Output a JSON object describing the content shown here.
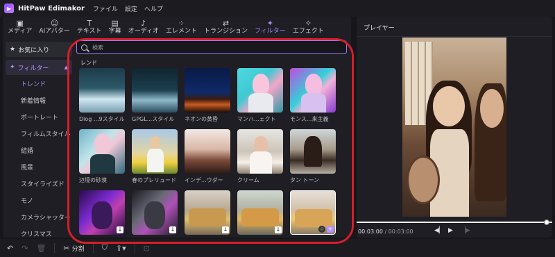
{
  "app": {
    "title": "HitPaw Edimakor"
  },
  "menu": [
    "ファイル",
    "設定",
    "ヘルプ"
  ],
  "toolbar": {
    "tools": [
      {
        "icon": "media-icon",
        "label": "メディア"
      },
      {
        "icon": "ai-avatar-icon",
        "label": "AIアバター"
      },
      {
        "icon": "text-icon",
        "label": "テキスト"
      },
      {
        "icon": "subtitle-icon",
        "label": "字幕"
      },
      {
        "icon": "audio-icon",
        "label": "オーディオ"
      },
      {
        "icon": "element-icon",
        "label": "エレメント"
      },
      {
        "icon": "transition-icon",
        "label": "トランジション"
      },
      {
        "icon": "filter-icon",
        "label": "フィルター"
      },
      {
        "icon": "effect-icon",
        "label": "エフェクト"
      }
    ],
    "active": "フィルター"
  },
  "sidebar": {
    "favorites": "お気に入り",
    "category": "フィルター",
    "items": [
      "トレンド",
      "新着情報",
      "ポートレート",
      "フィルムスタイル",
      "結婚",
      "風景",
      "スタイライズド",
      "モノ",
      "カメラシャッター",
      "クリスマス"
    ],
    "active": "トレンド"
  },
  "search": {
    "placeholder": "検索"
  },
  "section": {
    "title": "レンド"
  },
  "filters": [
    {
      "name": "Dlog ...9スタイル"
    },
    {
      "name": "GPGL...スタイル"
    },
    {
      "name": "ネオンの黄昏"
    },
    {
      "name": "マンハ...ェクト"
    },
    {
      "name": "モンス...来主義"
    },
    {
      "name": "辺境の砂漠"
    },
    {
      "name": "春のプレリュード"
    },
    {
      "name": "インデ...ウダー"
    },
    {
      "name": "クリーム"
    },
    {
      "name": "タン トーン"
    },
    {
      "name": ""
    },
    {
      "name": ""
    },
    {
      "name": ""
    },
    {
      "name": ""
    },
    {
      "name": ""
    }
  ],
  "player": {
    "title": "プレイヤー",
    "current_time": "00:03:00",
    "separator": " / ",
    "total_time": "00:03:00",
    "progress": 1.0
  },
  "bottombar": {
    "split_label": "分割"
  },
  "annotation_color": "#d81e2a",
  "accent_color": "#a98bff"
}
